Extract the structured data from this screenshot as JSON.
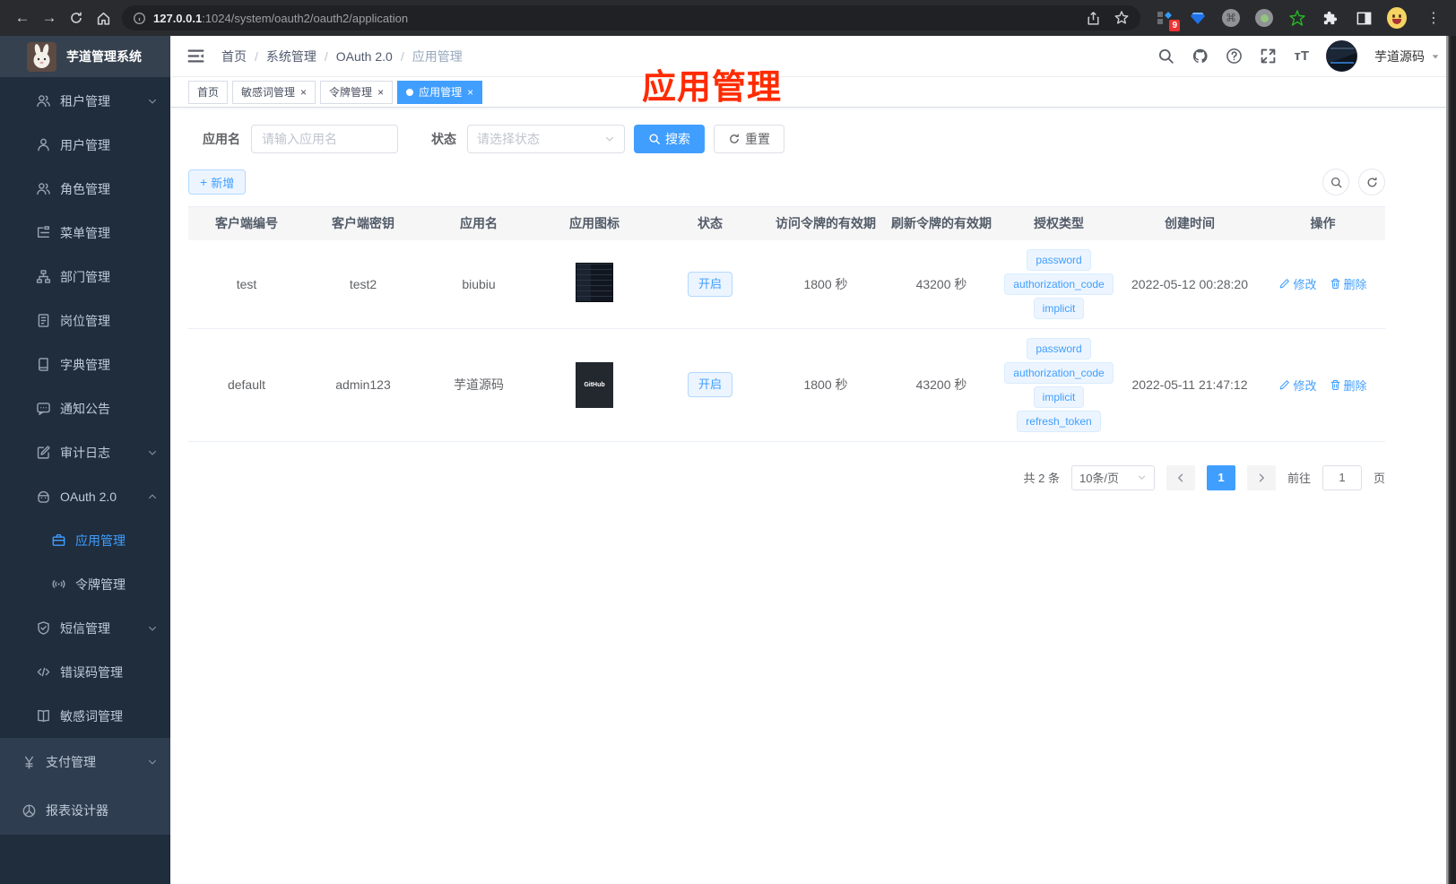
{
  "browser": {
    "url_domain": "127.0.0.1",
    "url_path": ":1024/system/oauth2/oauth2/application",
    "extension_badge": "9"
  },
  "sidebar": {
    "title": "芋道管理系统",
    "items": [
      {
        "label": "租户管理",
        "icon": "users",
        "arrow": "down"
      },
      {
        "label": "用户管理",
        "icon": "user"
      },
      {
        "label": "角色管理",
        "icon": "users"
      },
      {
        "label": "菜单管理",
        "icon": "tree"
      },
      {
        "label": "部门管理",
        "icon": "org"
      },
      {
        "label": "岗位管理",
        "icon": "badge"
      },
      {
        "label": "字典管理",
        "icon": "book"
      },
      {
        "label": "通知公告",
        "icon": "message"
      },
      {
        "label": "审计日志",
        "icon": "edit",
        "arrow": "down"
      },
      {
        "label": "OAuth 2.0",
        "icon": "robot",
        "arrow": "up"
      },
      {
        "label": "应用管理",
        "icon": "briefcase",
        "child": true,
        "active": true
      },
      {
        "label": "令牌管理",
        "icon": "broadcast",
        "child": true
      },
      {
        "label": "短信管理",
        "icon": "shield",
        "arrow": "down"
      },
      {
        "label": "错误码管理",
        "icon": "code"
      },
      {
        "label": "敏感词管理",
        "icon": "openbook"
      },
      {
        "label": "支付管理",
        "icon": "yen",
        "arrow": "down",
        "light": true
      },
      {
        "label": "报表设计器",
        "icon": "pie",
        "light": true
      }
    ]
  },
  "navbar": {
    "breadcrumb": [
      "首页",
      "系统管理",
      "OAuth 2.0",
      "应用管理"
    ],
    "username": "芋道源码"
  },
  "tabs": [
    {
      "label": "首页",
      "closable": false,
      "active": false
    },
    {
      "label": "敏感词管理",
      "closable": true,
      "active": false
    },
    {
      "label": "令牌管理",
      "closable": true,
      "active": false
    },
    {
      "label": "应用管理",
      "closable": true,
      "active": true
    }
  ],
  "annotation": "应用管理",
  "filters": {
    "name_label": "应用名",
    "name_placeholder": "请输入应用名",
    "status_label": "状态",
    "status_placeholder": "请选择状态",
    "search_label": "搜索",
    "reset_label": "重置"
  },
  "toolbar": {
    "add_label": "新增"
  },
  "table": {
    "headers": [
      "客户端编号",
      "客户端密钥",
      "应用名",
      "应用图标",
      "状态",
      "访问令牌的有效期",
      "刷新令牌的有效期",
      "授权类型",
      "创建时间",
      "操作"
    ],
    "action_edit": "修改",
    "action_delete": "删除",
    "rows": [
      {
        "client_id": "test",
        "secret": "test2",
        "name": "biubiu",
        "icon_type": "screenshot",
        "icon_text": "",
        "status": "开启",
        "access_token_validity": "1800 秒",
        "refresh_token_validity": "43200 秒",
        "grants": [
          "password",
          "authorization_code",
          "implicit"
        ],
        "created": "2022-05-12 00:28:20"
      },
      {
        "client_id": "default",
        "secret": "admin123",
        "name": "芋道源码",
        "icon_type": "github",
        "icon_text": "GitHub",
        "status": "开启",
        "access_token_validity": "1800 秒",
        "refresh_token_validity": "43200 秒",
        "grants": [
          "password",
          "authorization_code",
          "implicit",
          "refresh_token"
        ],
        "created": "2022-05-11 21:47:12"
      }
    ]
  },
  "pagination": {
    "total": "共 2 条",
    "page_size": "10条/页",
    "current_page": "1",
    "goto_label": "前往",
    "goto_value": "1",
    "page_suffix": "页"
  },
  "colors": {
    "accent": "#409eff",
    "annotation": "#ff2b00",
    "sidebar_bg": "#1f2d3d"
  }
}
